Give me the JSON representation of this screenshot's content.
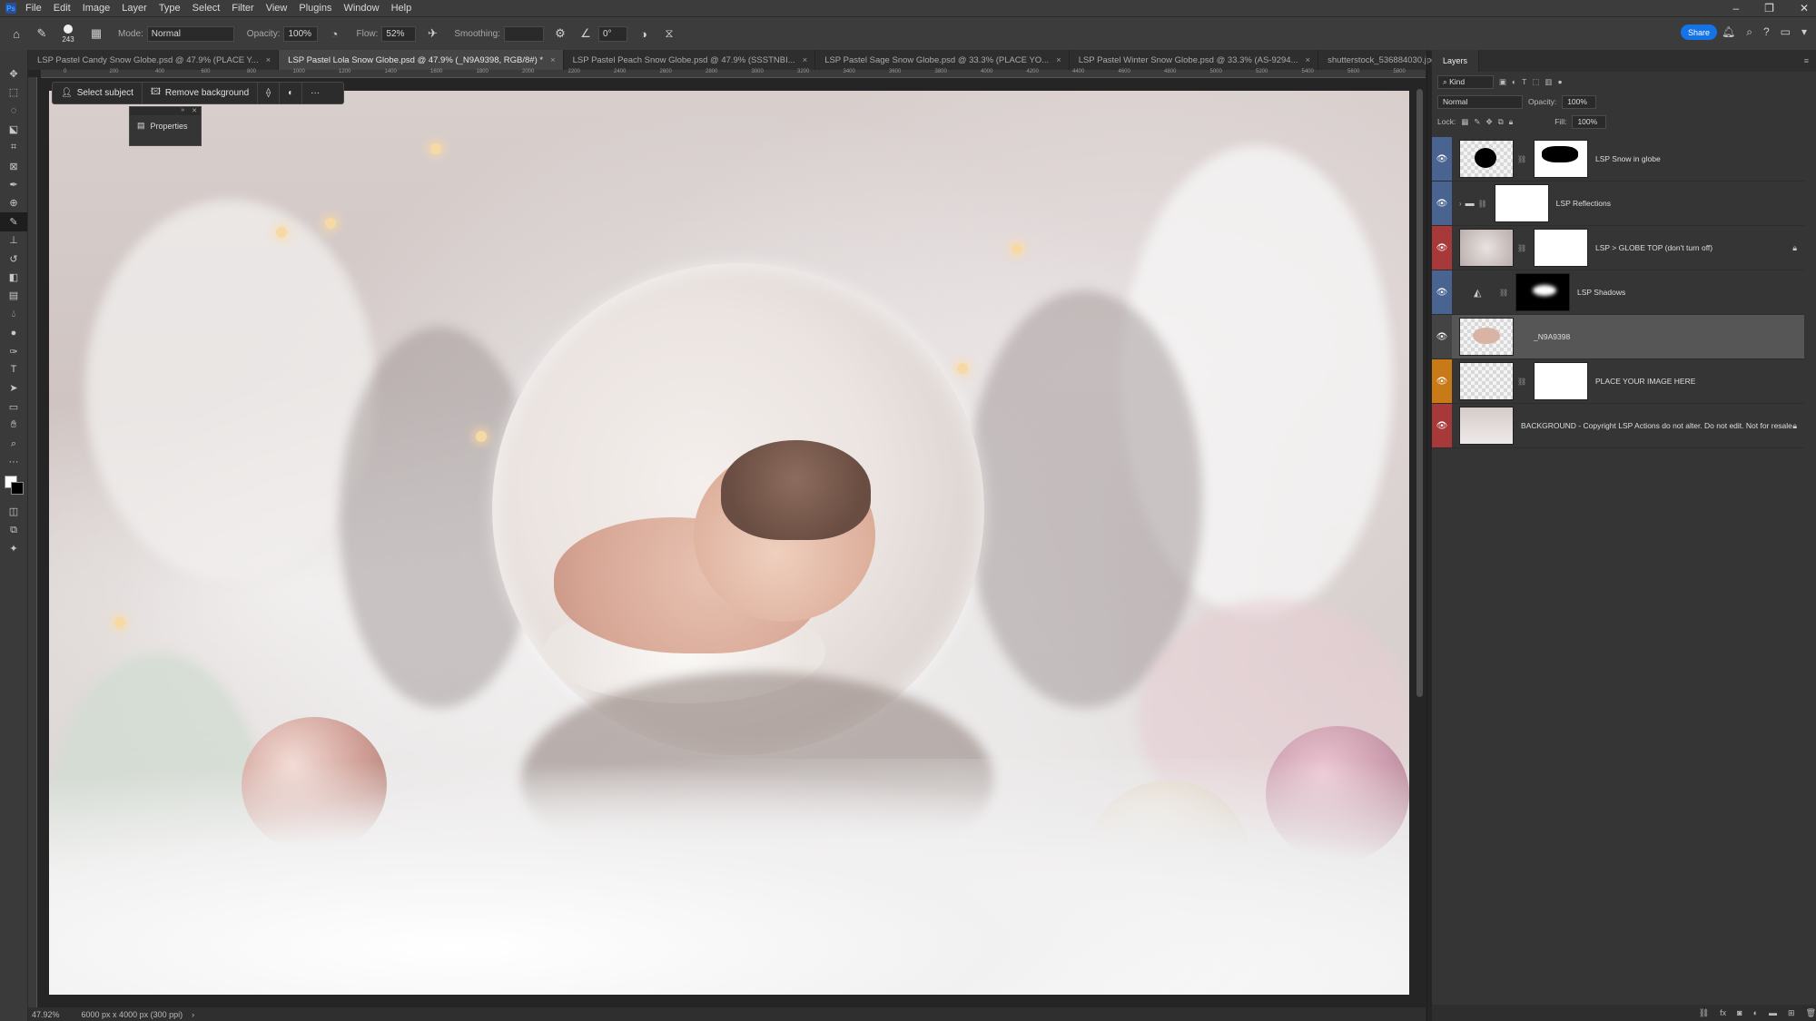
{
  "menu": {
    "logo": "Ps",
    "items": [
      "File",
      "Edit",
      "Image",
      "Layer",
      "Type",
      "Select",
      "Filter",
      "View",
      "Plugins",
      "Window",
      "Help"
    ]
  },
  "window_controls": [
    "–",
    "❐",
    "✕"
  ],
  "options": {
    "brush_size": "243",
    "mode_label": "Mode:",
    "mode_value": "Normal",
    "opacity_label": "Opacity:",
    "opacity_value": "100%",
    "flow_label": "Flow:",
    "flow_value": "52%",
    "smoothing_label": "Smoothing:",
    "angle_value": "0°",
    "share_label": "Share"
  },
  "tabs": [
    {
      "label": "LSP Pastel Candy Snow Globe.psd @ 47.9% (PLACE Y...",
      "active": false
    },
    {
      "label": "LSP Pastel Lola Snow Globe.psd @ 47.9% (_N9A9398, RGB/8#) *",
      "active": true
    },
    {
      "label": "LSP Pastel Peach Snow Globe.psd @ 47.9% (SSSTNBI...",
      "active": false
    },
    {
      "label": "LSP Pastel Sage Snow Globe.psd @ 33.3% (PLACE YO...",
      "active": false
    },
    {
      "label": "LSP Pastel Winter Snow Globe.psd @ 33.3% (AS-9294...",
      "active": false
    },
    {
      "label": "shutterstock_536884030.jpg @ 33.3% (RGB...",
      "active": false
    }
  ],
  "ruler_numbers": [
    "0",
    "200",
    "400",
    "600",
    "800",
    "1000",
    "1200",
    "1400",
    "1600",
    "1800",
    "2000",
    "2200",
    "2400",
    "2600",
    "2800",
    "3000",
    "3200",
    "3400",
    "3600",
    "3800",
    "4000",
    "4200",
    "4400",
    "4600",
    "4800",
    "5000",
    "5200",
    "5400",
    "5600",
    "5800"
  ],
  "context_bar": {
    "select_subject": "Select subject",
    "remove_background": "Remove background",
    "more": "···"
  },
  "properties_panel": {
    "label": "Properties"
  },
  "status": {
    "zoom": "47.92%",
    "doc_info": "6000 px x 4000 px (300 ppi)"
  },
  "layers_panel": {
    "tab_label": "Layers",
    "filter_kind": "Kind",
    "blend_mode": "Normal",
    "opacity_label": "Opacity:",
    "opacity_value": "100%",
    "lock_label": "Lock:",
    "fill_label": "Fill:",
    "fill_value": "100%",
    "colors": {
      "blue": "#4a6491",
      "red": "#a8393a",
      "orange": "#c87a16"
    },
    "layers": [
      {
        "name": "LSP Snow in globe",
        "tag": "blue",
        "locked": false,
        "selected": false
      },
      {
        "name": "LSP Reflections",
        "tag": "blue",
        "locked": false,
        "selected": false
      },
      {
        "name": "LSP > GLOBE TOP (don't turn off)",
        "tag": "red",
        "locked": true,
        "selected": false
      },
      {
        "name": "LSP Shadows",
        "tag": "blue",
        "locked": false,
        "selected": false
      },
      {
        "name": "_N9A9398",
        "tag": "none",
        "locked": false,
        "selected": true
      },
      {
        "name": "PLACE YOUR IMAGE HERE",
        "tag": "orange",
        "locked": false,
        "selected": false
      },
      {
        "name": "BACKGROUND - Copyright LSP Actions do not alter. Do not edit. Not for resale.",
        "tag": "red",
        "locked": true,
        "selected": false
      }
    ]
  }
}
